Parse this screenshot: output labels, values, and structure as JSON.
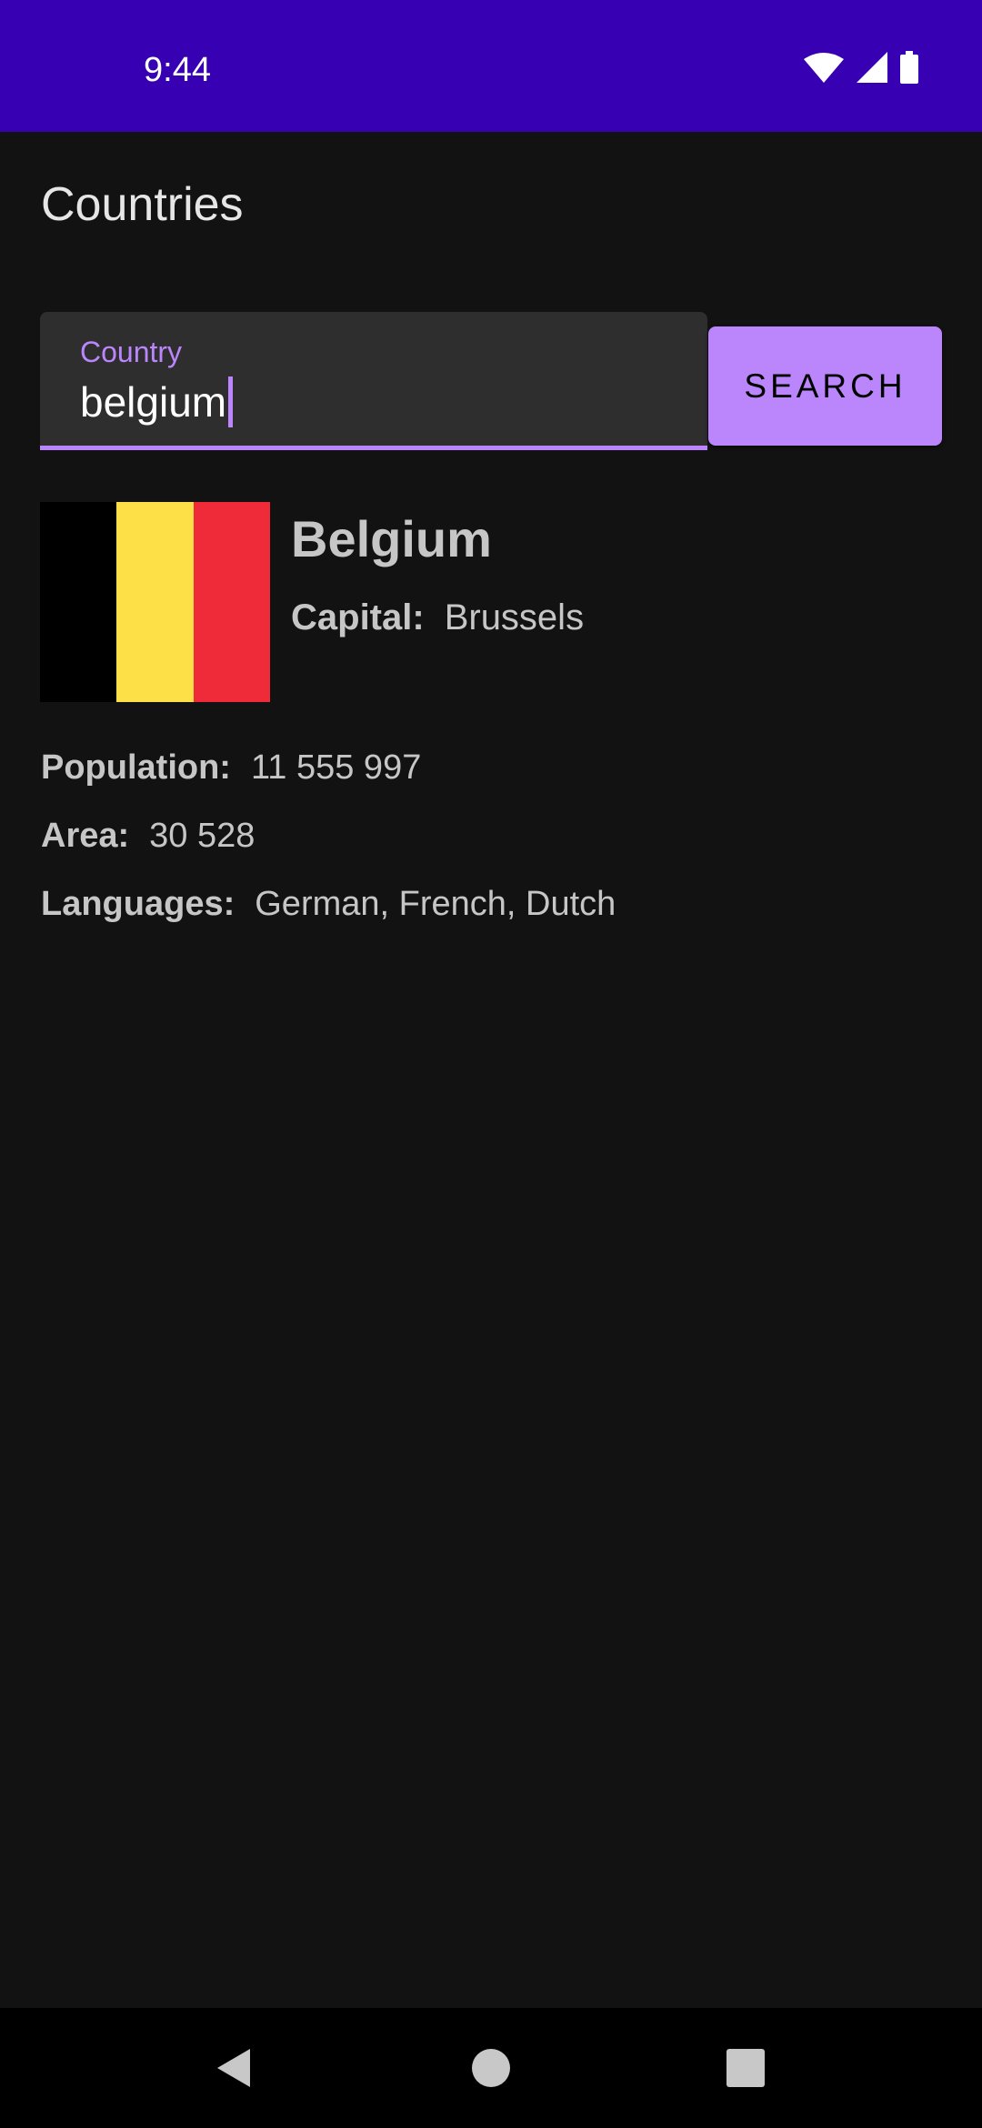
{
  "status_bar": {
    "time": "9:44",
    "icons": [
      "wifi-icon",
      "cellular-signal-icon",
      "battery-icon"
    ],
    "background": "#3700b3"
  },
  "app_bar": {
    "title": "Countries"
  },
  "search": {
    "label": "Country",
    "value": "belgium",
    "button_label": "SEARCH",
    "accent_color": "#bb86fc"
  },
  "result": {
    "name": "Belgium",
    "flag_colors": [
      "#000000",
      "#fde047",
      "#ef2b3a"
    ],
    "capital": {
      "label": "Capital:",
      "value": "Brussels"
    },
    "population": {
      "label": "Population:",
      "value": "11 555 997"
    },
    "area": {
      "label": "Area:",
      "value": "30 528"
    },
    "languages": {
      "label": "Languages:",
      "value": "German, French, Dutch"
    }
  },
  "nav_bar": {
    "buttons": [
      "back-icon",
      "home-icon",
      "recents-icon"
    ]
  }
}
